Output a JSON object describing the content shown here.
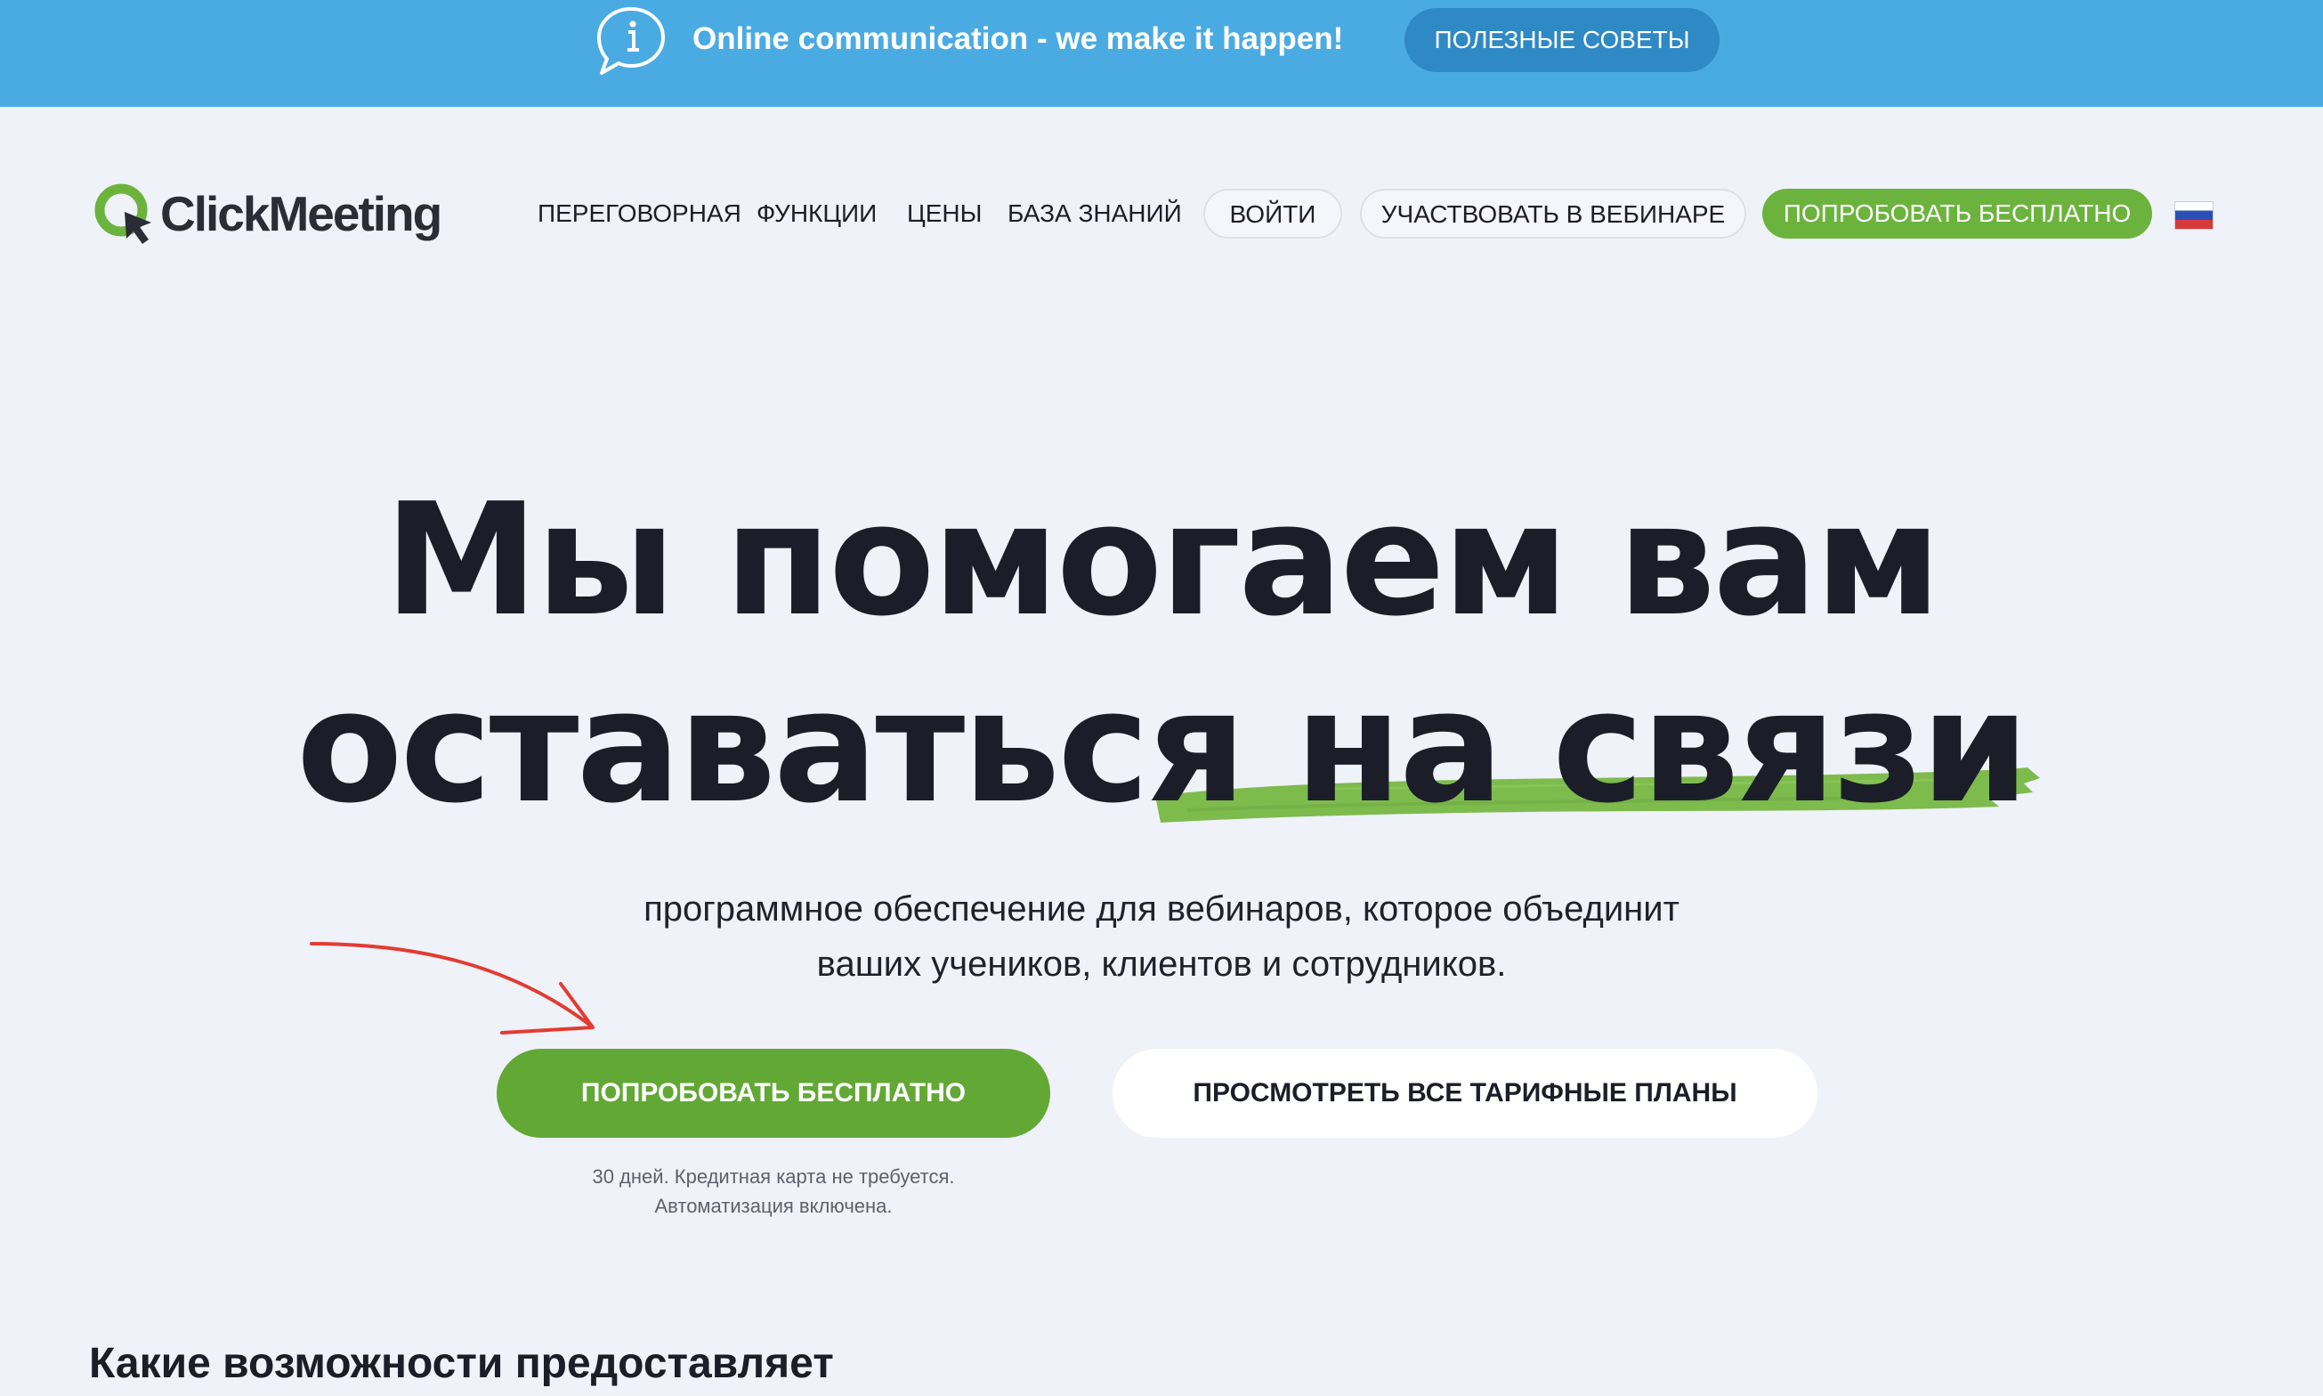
{
  "banner": {
    "text": "Online communication - we make it happen!",
    "button_label": "ПОЛЕЗНЫЕ СОВЕТЫ",
    "icon": "info-chat-icon"
  },
  "header": {
    "logo_text": "ClickMeeting",
    "nav": {
      "room": "ПЕРЕГОВОРНАЯ",
      "features": "ФУНКЦИИ",
      "pricing": "ЦЕНЫ",
      "knowledge": "БАЗА ЗНАНИЙ"
    },
    "login_label": "ВОЙТИ",
    "attend_label": "УЧАСТВОВАТЬ В ВЕБИНАРЕ",
    "try_free_label": "ПОПРОБОВАТЬ БЕСПЛАТНО",
    "language_flag": "russia-flag-icon"
  },
  "hero": {
    "title_line1": "Мы помогаем вам",
    "title_line2": "оставаться на связи",
    "subtitle_line1": "программное обеспечение для вебинаров, которое объединит",
    "subtitle_line2": "ваших учеников, клиентов и сотрудников.",
    "cta_primary": "ПОПРОБОВАТЬ БЕСПЛАТНО",
    "cta_secondary": "ПРОСМОТРЕТЬ ВСЕ ТАРИФНЫЕ ПЛАНЫ",
    "note_line1": "30 дней. Кредитная карта не требуется.",
    "note_line2": "Автоматизация включена."
  },
  "section": {
    "heading": "Какие возможности предоставляет"
  },
  "colors": {
    "banner": "#4aabe3",
    "banner_button": "#2f89c4",
    "brand_green": "#6cb33e",
    "cta_green": "#62a835",
    "page_background": "#eff2f8",
    "annotation_arrow": "#e23b33"
  }
}
